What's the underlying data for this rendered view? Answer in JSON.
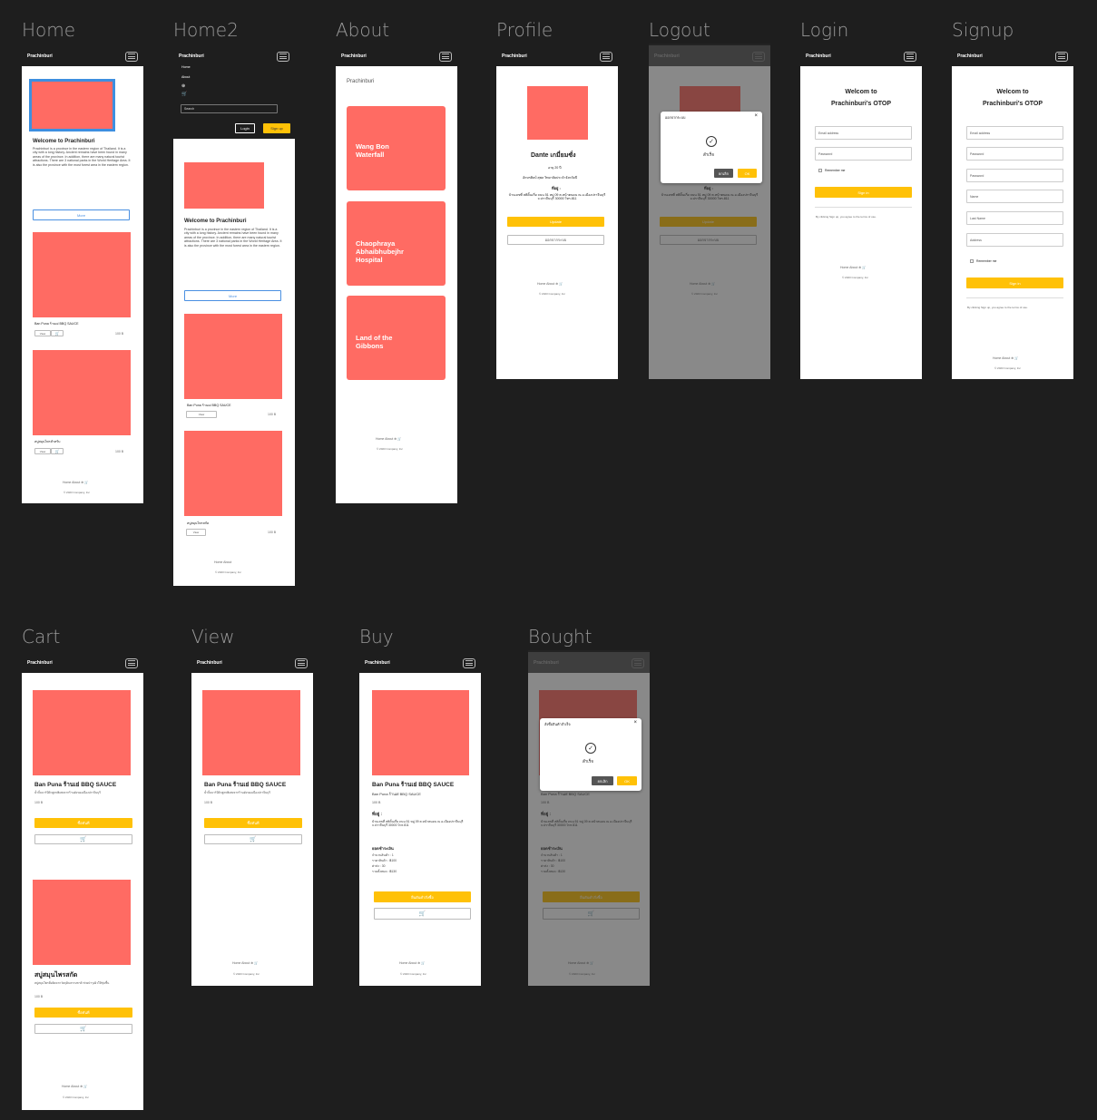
{
  "app": {
    "brand": "Prachinburi"
  },
  "frames": {
    "home": "Home",
    "home2": "Home2",
    "about": "About",
    "profile": "Profile",
    "logout": "Logout",
    "login": "Login",
    "signup": "Signup",
    "cart": "Cart",
    "view": "View",
    "buy": "Buy",
    "bought": "Bought"
  },
  "home": {
    "welcome": "Welcome to Prachinburi",
    "desc": "Prachinburi is a province in the eastern region of Thailand. It is a city with a long history. Ancient remains have been found in many areas of the province. In addition, there are many natural tourist attractions. There are 3 national parks in the World Heritage Area. It is also the province with the most forest area in the eastern region.",
    "more": "More",
    "p1_name": "Ban Puna ร้านเย่ BBQ SAUCE",
    "p1_price": "100 B",
    "p2_name": "สบู่สมุนไพรสำหรับ",
    "p2_price": "100 B",
    "view": "View"
  },
  "home2": {
    "menu": [
      "Home",
      "About"
    ],
    "search": "Search",
    "login": "Login",
    "signup": "Sign up",
    "p2_name": "สบู่สมุนไพรสกัด"
  },
  "about": {
    "title": "Prachinburi",
    "places": [
      "Wang Bon Waterfall",
      "Chaophraya Abhaibhubejhr Hospital",
      "Land of the Gibbons"
    ]
  },
  "profile": {
    "name": "Dante เกมี่ยมซั่ง",
    "age": "อายุ 20 ปี",
    "sub": "อักษรศิลป์ สุพล วิทยาลัยประจำจังหวัดปี",
    "addr_label": "ที่อยู่ :",
    "addr": "บ้านเลขที่ สติดิ้นเกี่ย ถนน 51 หมู่ 09 ต.หน้าตนดน ณ อ.เมืองปราจีนบุรี จ.ปราจีนบุรี 30000 โทร.811",
    "edit": "Update",
    "logout": "ออกจากระบบ"
  },
  "logout_modal": {
    "title": "ออกจากระบบ",
    "msg": "สำเร็จ",
    "cancel": "ยกเลิก",
    "ok": "OK"
  },
  "login": {
    "title1": "Welcom to",
    "title2": "Prachinburi's OTOP",
    "email": "Email address",
    "password": "Password",
    "remember": "Remember me",
    "signin": "Sign in",
    "terms": "By clicking Sign up, you agree to the terms of use."
  },
  "signup": {
    "title1": "Welcom to",
    "title2": "Prachinburi's OTOP",
    "fields": [
      "Email address",
      "Password",
      "Password",
      "Name",
      "Last Name",
      "Address"
    ],
    "remember": "Remember me",
    "signin": "Sign in",
    "terms": "By clicking Sign up, you agree to the terms of use."
  },
  "cart": {
    "p1_title": "Ban Puna ร้านเย่ BBQ SAUCE",
    "p1_desc": "น้ำจิ้มบาร์บีคิวสูตรพิเศษจากร้านดังของเมืองปราจีนบุรี",
    "p1_price": "100 B",
    "p2_title": "สบู่สมุนไพรสกัด",
    "p2_desc": "สบู่สมุนไพรที่ผลิตจากวัตถุดิบธรรมชาติ ช่วยบำรุงผิวให้ชุ่มชื้น",
    "p2_price": "100 B",
    "buy": "ซื้อทันที"
  },
  "view": {
    "title": "Ban Puna ร้านเย่ BBQ SAUCE",
    "desc": "น้ำจิ้มบาร์บีคิวสูตรพิเศษจากร้านดังของเมืองปราจีนบุรี",
    "price": "100 B",
    "buy": "ซื้อทันที"
  },
  "buy": {
    "title": "Ban Puna ร้านเย่ BBQ SAUCE",
    "sub": "Ban Puna ร้านเย่ BBQ SAUCE",
    "price": "100 B",
    "addr_label": "ที่อยู่ :",
    "addr": "บ้านเลขที่ สติดิ้นเกี่ย ถนน 51 หมู่ 09 ต.หน้าตนดน ณ อ.เมืองปราจีนบุรี จ.ปราจีนบุรี 30000 โทร.811",
    "sum_title": "ยอดชำระเงิน",
    "sum": [
      "จำนวนสินค้า : 1",
      "ราคาสินค้า : ฿100",
      "ค่าส่ง : 30",
      "รวมทั้งหมด : ฿130"
    ],
    "confirm": "ยืนยันคำสั่งซื้อ"
  },
  "bought_modal": {
    "title": "สั่งซื้อสินค้าสำเร็จ",
    "msg": "สำเร็จ",
    "cancel": "ยกเลิก",
    "ok": "OK"
  },
  "footer": {
    "home": "Home",
    "about": "About",
    "copy": "© 2023 Company, Inc"
  },
  "colors": {
    "accent": "#ffc107",
    "placeholder": "#ff6b63",
    "bg": "#1e1e1e",
    "link": "#4a90e2"
  }
}
